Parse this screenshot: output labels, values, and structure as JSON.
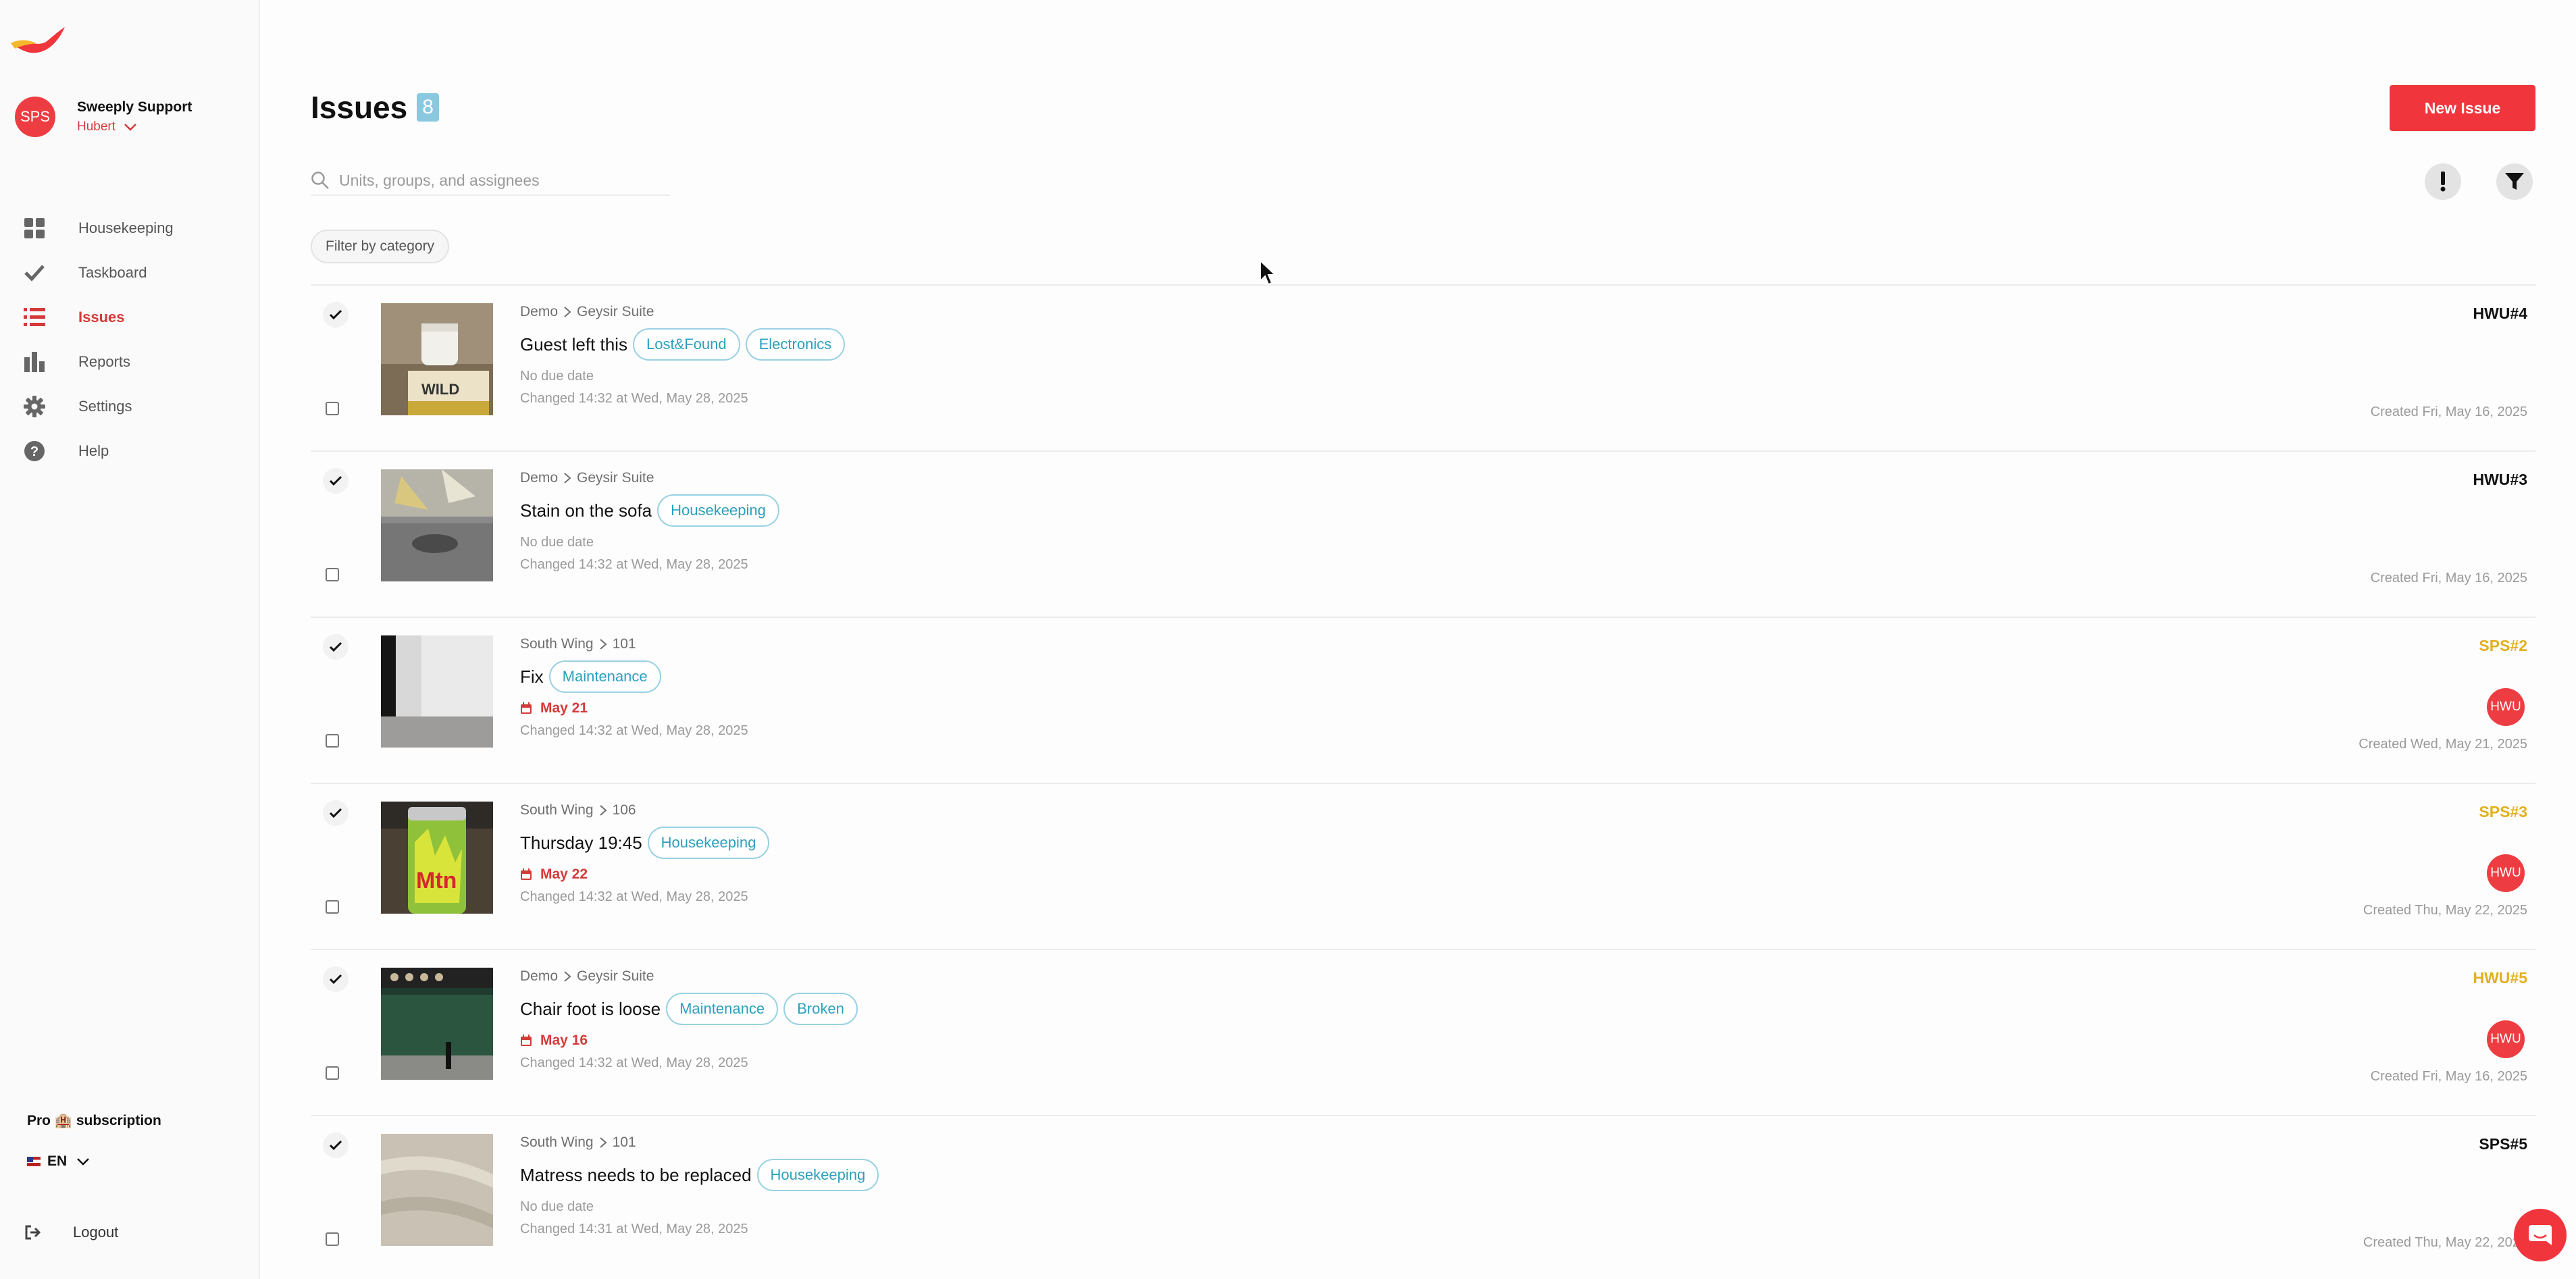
{
  "brand": {
    "accent": "#f0353d",
    "tag_color": "#2c9fbd",
    "badge_color": "#8ac8e0",
    "ref_highlight": "#e2b020"
  },
  "account": {
    "initials": "SPS",
    "name": "Sweeply Support",
    "user": "Hubert"
  },
  "nav": [
    {
      "label": "Housekeeping",
      "icon": "grid-icon"
    },
    {
      "label": "Taskboard",
      "icon": "check-icon"
    },
    {
      "label": "Issues",
      "icon": "list-icon",
      "active": true
    },
    {
      "label": "Reports",
      "icon": "bar-chart-icon"
    },
    {
      "label": "Settings",
      "icon": "gear-icon"
    },
    {
      "label": "Help",
      "icon": "help-icon"
    }
  ],
  "sidebar_footer": {
    "plan": "Pro 🏨 subscription",
    "language": "EN",
    "logout": "Logout"
  },
  "page": {
    "title": "Issues",
    "count": "8",
    "new_button": "New Issue"
  },
  "search": {
    "placeholder": "Units, groups, and assignees"
  },
  "filter": {
    "category_label": "Filter by category"
  },
  "issues": [
    {
      "group": "Demo",
      "unit": "Geysir Suite",
      "title": "Guest left this",
      "tags": [
        "Lost&Found",
        "Electronics"
      ],
      "due": "No due date",
      "due_set": false,
      "changed": "Changed 14:32 at Wed, May 28, 2025",
      "ref": "HWU#4",
      "ref_highlight": false,
      "assignee": "",
      "created": "Created Fri, May 16, 2025",
      "thumb": "lamp"
    },
    {
      "group": "Demo",
      "unit": "Geysir Suite",
      "title": "Stain on the sofa",
      "tags": [
        "Housekeeping"
      ],
      "due": "No due date",
      "due_set": false,
      "changed": "Changed 14:32 at Wed, May 28, 2025",
      "ref": "HWU#3",
      "ref_highlight": false,
      "assignee": "",
      "created": "Created Fri, May 16, 2025",
      "thumb": "sofa"
    },
    {
      "group": "South Wing",
      "unit": "101",
      "title": "Fix",
      "tags": [
        "Maintenance"
      ],
      "due": "May 21",
      "due_set": true,
      "changed": "Changed 14:32 at Wed, May 28, 2025",
      "ref": "SPS#2",
      "ref_highlight": true,
      "assignee": "HWU",
      "created": "Created Wed, May 21, 2025",
      "thumb": "wall"
    },
    {
      "group": "South Wing",
      "unit": "106",
      "title": "Thursday 19:45",
      "tags": [
        "Housekeeping"
      ],
      "due": "May 22",
      "due_set": true,
      "changed": "Changed 14:32 at Wed, May 28, 2025",
      "ref": "SPS#3",
      "ref_highlight": true,
      "assignee": "HWU",
      "created": "Created Thu, May 22, 2025",
      "thumb": "can"
    },
    {
      "group": "Demo",
      "unit": "Geysir Suite",
      "title": "Chair foot is loose",
      "tags": [
        "Maintenance",
        "Broken"
      ],
      "due": "May 16",
      "due_set": true,
      "changed": "Changed 14:32 at Wed, May 28, 2025",
      "ref": "HWU#5",
      "ref_highlight": true,
      "assignee": "HWU",
      "created": "Created Fri, May 16, 2025",
      "thumb": "chair"
    },
    {
      "group": "South Wing",
      "unit": "101",
      "title": "Matress needs to be replaced",
      "tags": [
        "Housekeeping"
      ],
      "due": "No due date",
      "due_set": false,
      "changed": "Changed 14:31 at Wed, May 28, 2025",
      "ref": "SPS#5",
      "ref_highlight": false,
      "assignee": "",
      "created": "Created Thu, May 22, 2025",
      "thumb": "mattress"
    }
  ]
}
